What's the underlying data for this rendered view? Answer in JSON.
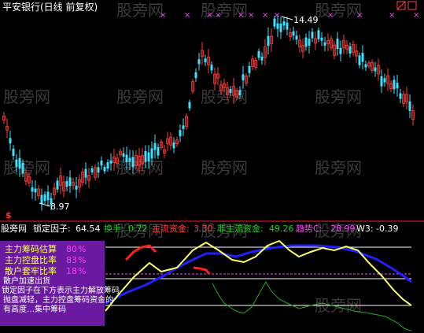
{
  "top_panel": {
    "title": "平安银行(日线 前复权)",
    "high_label": "14.49",
    "low_label": "8.97",
    "marker_symbol": "$",
    "cross_marker": "×",
    "cross_count": 12,
    "watermark": "股旁网"
  },
  "indicator_bar": {
    "name": "股旁网",
    "lock_label": "锁定因子:",
    "lock_value": "64.54",
    "turnover_label": "换手:",
    "turnover_value": "0.72",
    "main_capital_label": "主流资金:",
    "main_capital_value": "3.30",
    "non_main_label": "非主流资金:",
    "non_main_value": "49.26",
    "trend_label": "趋势C:",
    "trend_value": "28.99",
    "w3_label": "W3:",
    "w3_value": "-0.39"
  },
  "legend_box": {
    "rows": [
      {
        "label": "主力筹码估算",
        "value": "80",
        "unit": "%"
      },
      {
        "label": "主力控盘比率",
        "value": "83",
        "unit": "%"
      },
      {
        "label": "散户套牢比率",
        "value": "18",
        "unit": "%"
      }
    ],
    "overlay_lines": [
      "散户加速出货",
      "锁定因子在下方表示主力解放筹码",
      "抛盘减轻，主力控盘筹码资金的",
      "有高度…集中筹码"
    ]
  },
  "colors": {
    "background": "#000000",
    "up_candle": "#ff3b3b",
    "down_candle": "#40e0ff",
    "accent_magenta": "#ff40ff",
    "yellow_line": "#ffff66",
    "blue_line": "#2020ff",
    "green_line": "#22aa22",
    "red_line": "#ff2020",
    "legend_bg": "#6a1aa0"
  },
  "chart_data": [
    {
      "type": "candlestick",
      "title": "平安银行(日线 前复权)",
      "price_range": [
        8.5,
        15.0
      ],
      "annotated_high": 14.49,
      "annotated_low": 8.97,
      "trend": "low near 8.97 then rally to 14.49 then pullback"
    },
    {
      "type": "line",
      "series": [
        {
          "name": "主力筹码估算",
          "color": "yellow"
        },
        {
          "name": "主力控盘比率",
          "color": "blue"
        },
        {
          "name": "锁定因子",
          "color": "green"
        }
      ]
    }
  ]
}
